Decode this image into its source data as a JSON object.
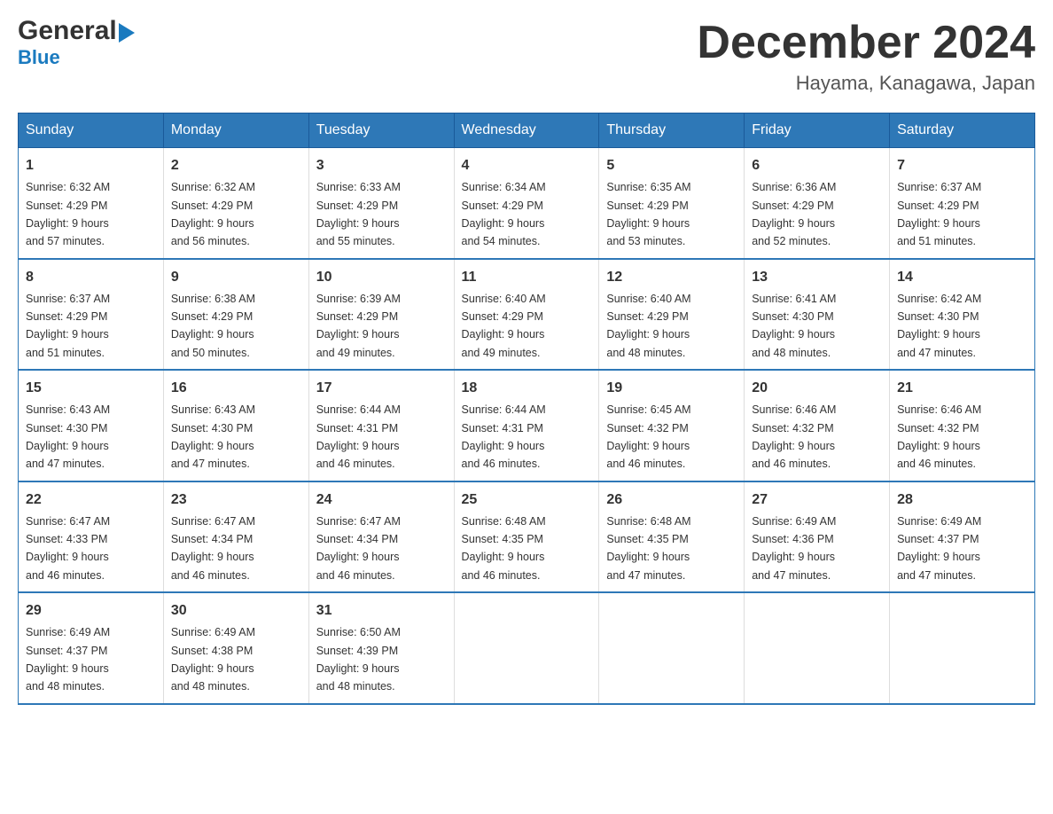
{
  "logo": {
    "general": "General",
    "blue": "Blue",
    "triangle": "▶"
  },
  "title": "December 2024",
  "location": "Hayama, Kanagawa, Japan",
  "headers": [
    "Sunday",
    "Monday",
    "Tuesday",
    "Wednesday",
    "Thursday",
    "Friday",
    "Saturday"
  ],
  "weeks": [
    [
      {
        "day": "1",
        "sunrise": "6:32 AM",
        "sunset": "4:29 PM",
        "daylight": "9 hours and 57 minutes."
      },
      {
        "day": "2",
        "sunrise": "6:32 AM",
        "sunset": "4:29 PM",
        "daylight": "9 hours and 56 minutes."
      },
      {
        "day": "3",
        "sunrise": "6:33 AM",
        "sunset": "4:29 PM",
        "daylight": "9 hours and 55 minutes."
      },
      {
        "day": "4",
        "sunrise": "6:34 AM",
        "sunset": "4:29 PM",
        "daylight": "9 hours and 54 minutes."
      },
      {
        "day": "5",
        "sunrise": "6:35 AM",
        "sunset": "4:29 PM",
        "daylight": "9 hours and 53 minutes."
      },
      {
        "day": "6",
        "sunrise": "6:36 AM",
        "sunset": "4:29 PM",
        "daylight": "9 hours and 52 minutes."
      },
      {
        "day": "7",
        "sunrise": "6:37 AM",
        "sunset": "4:29 PM",
        "daylight": "9 hours and 51 minutes."
      }
    ],
    [
      {
        "day": "8",
        "sunrise": "6:37 AM",
        "sunset": "4:29 PM",
        "daylight": "9 hours and 51 minutes."
      },
      {
        "day": "9",
        "sunrise": "6:38 AM",
        "sunset": "4:29 PM",
        "daylight": "9 hours and 50 minutes."
      },
      {
        "day": "10",
        "sunrise": "6:39 AM",
        "sunset": "4:29 PM",
        "daylight": "9 hours and 49 minutes."
      },
      {
        "day": "11",
        "sunrise": "6:40 AM",
        "sunset": "4:29 PM",
        "daylight": "9 hours and 49 minutes."
      },
      {
        "day": "12",
        "sunrise": "6:40 AM",
        "sunset": "4:29 PM",
        "daylight": "9 hours and 48 minutes."
      },
      {
        "day": "13",
        "sunrise": "6:41 AM",
        "sunset": "4:30 PM",
        "daylight": "9 hours and 48 minutes."
      },
      {
        "day": "14",
        "sunrise": "6:42 AM",
        "sunset": "4:30 PM",
        "daylight": "9 hours and 47 minutes."
      }
    ],
    [
      {
        "day": "15",
        "sunrise": "6:43 AM",
        "sunset": "4:30 PM",
        "daylight": "9 hours and 47 minutes."
      },
      {
        "day": "16",
        "sunrise": "6:43 AM",
        "sunset": "4:30 PM",
        "daylight": "9 hours and 47 minutes."
      },
      {
        "day": "17",
        "sunrise": "6:44 AM",
        "sunset": "4:31 PM",
        "daylight": "9 hours and 46 minutes."
      },
      {
        "day": "18",
        "sunrise": "6:44 AM",
        "sunset": "4:31 PM",
        "daylight": "9 hours and 46 minutes."
      },
      {
        "day": "19",
        "sunrise": "6:45 AM",
        "sunset": "4:32 PM",
        "daylight": "9 hours and 46 minutes."
      },
      {
        "day": "20",
        "sunrise": "6:46 AM",
        "sunset": "4:32 PM",
        "daylight": "9 hours and 46 minutes."
      },
      {
        "day": "21",
        "sunrise": "6:46 AM",
        "sunset": "4:32 PM",
        "daylight": "9 hours and 46 minutes."
      }
    ],
    [
      {
        "day": "22",
        "sunrise": "6:47 AM",
        "sunset": "4:33 PM",
        "daylight": "9 hours and 46 minutes."
      },
      {
        "day": "23",
        "sunrise": "6:47 AM",
        "sunset": "4:34 PM",
        "daylight": "9 hours and 46 minutes."
      },
      {
        "day": "24",
        "sunrise": "6:47 AM",
        "sunset": "4:34 PM",
        "daylight": "9 hours and 46 minutes."
      },
      {
        "day": "25",
        "sunrise": "6:48 AM",
        "sunset": "4:35 PM",
        "daylight": "9 hours and 46 minutes."
      },
      {
        "day": "26",
        "sunrise": "6:48 AM",
        "sunset": "4:35 PM",
        "daylight": "9 hours and 47 minutes."
      },
      {
        "day": "27",
        "sunrise": "6:49 AM",
        "sunset": "4:36 PM",
        "daylight": "9 hours and 47 minutes."
      },
      {
        "day": "28",
        "sunrise": "6:49 AM",
        "sunset": "4:37 PM",
        "daylight": "9 hours and 47 minutes."
      }
    ],
    [
      {
        "day": "29",
        "sunrise": "6:49 AM",
        "sunset": "4:37 PM",
        "daylight": "9 hours and 48 minutes."
      },
      {
        "day": "30",
        "sunrise": "6:49 AM",
        "sunset": "4:38 PM",
        "daylight": "9 hours and 48 minutes."
      },
      {
        "day": "31",
        "sunrise": "6:50 AM",
        "sunset": "4:39 PM",
        "daylight": "9 hours and 48 minutes."
      },
      null,
      null,
      null,
      null
    ]
  ]
}
